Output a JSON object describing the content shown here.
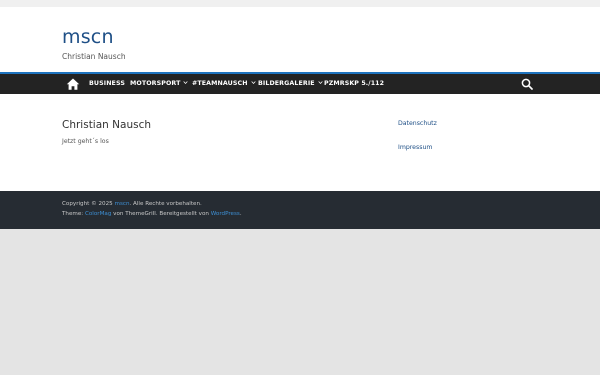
{
  "site": {
    "title": "mscn",
    "tagline": "Christian Nausch"
  },
  "nav": {
    "home_icon": "home-icon",
    "search_icon": "search-icon",
    "items": [
      {
        "label": "BUSINESS",
        "dropdown": false
      },
      {
        "label": "MOTORSPORT",
        "dropdown": true
      },
      {
        "label": "#TEAMNAUSCH",
        "dropdown": true
      },
      {
        "label": "BILDERGALERIE",
        "dropdown": true
      },
      {
        "label": "PZMRSKP 5./112",
        "dropdown": false
      }
    ]
  },
  "post": {
    "title": "Christian Nausch",
    "excerpt": "Jetzt geht´s los"
  },
  "sidebar": {
    "links": [
      "Datenschutz",
      "Impressum"
    ]
  },
  "footer": {
    "copyright_prefix": "Copyright © 2025 ",
    "site_link": "mscn",
    "copyright_suffix": ". Alle Rechte vorbehalten.",
    "theme_prefix": "Theme: ",
    "theme_link": "ColorMag",
    "theme_middle": " von ThemeGrill. Bereitgestellt von ",
    "wp_link": "WordPress",
    "theme_suffix": "."
  },
  "colors": {
    "accent": "#1e73be",
    "nav_bg": "#232323",
    "footer_bg": "#262c33",
    "title": "#1e4f86"
  }
}
